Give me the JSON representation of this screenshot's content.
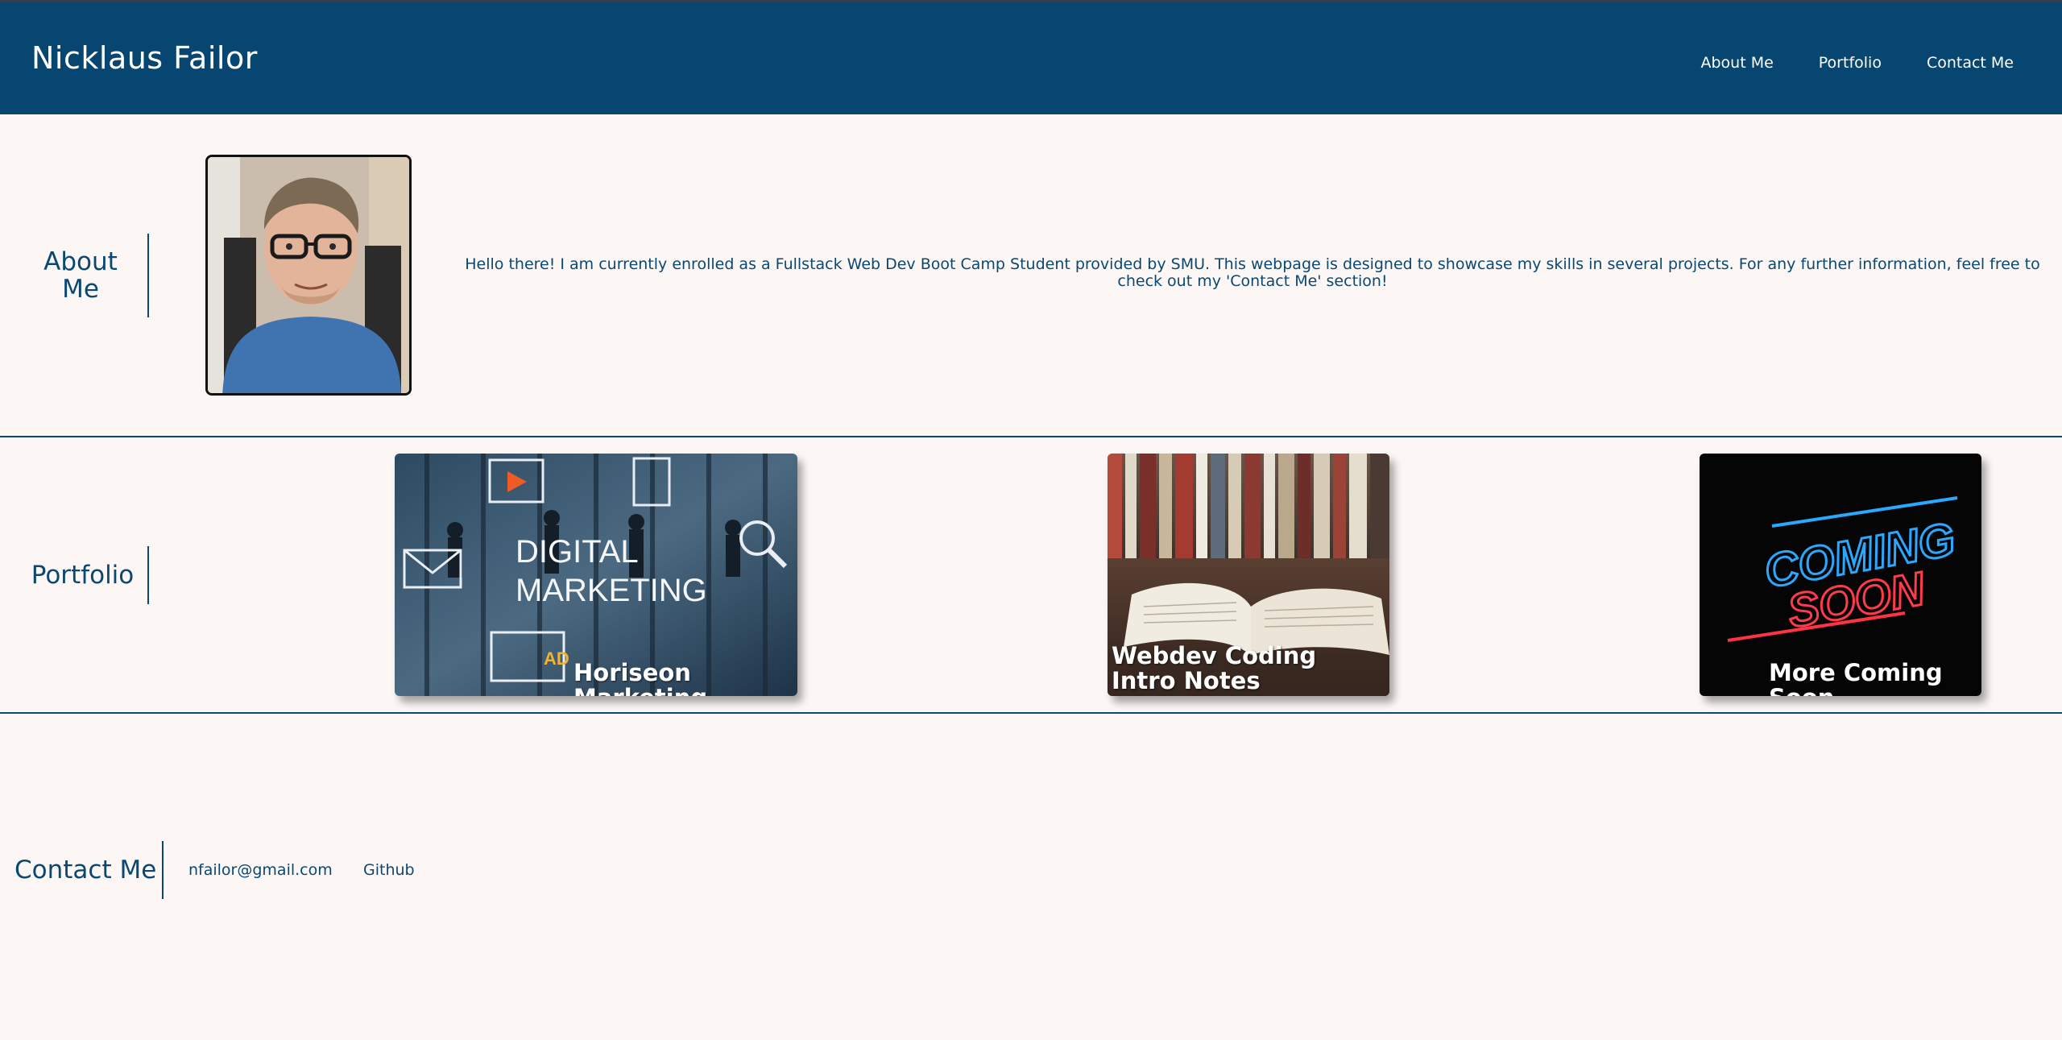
{
  "header": {
    "title": "Nicklaus Failor",
    "nav": [
      "About Me",
      "Portfolio",
      "Contact Me"
    ]
  },
  "about": {
    "heading_line1": "About",
    "heading_line2": "Me",
    "text": "Hello there! I am currently enrolled as a Fullstack Web Dev Boot Camp Student provided by SMU. This webpage is designed to showcase my skills in several projects. For any further information, feel free to check out my 'Contact Me' section!"
  },
  "portfolio": {
    "heading": "Portfolio",
    "cards": [
      {
        "caption": "Horiseon Marketing",
        "image_text": [
          "DIGITAL",
          "MARKETING"
        ],
        "icon": "digital-marketing-image"
      },
      {
        "caption": "Webdev Coding Intro Notes",
        "icon": "open-book-image"
      },
      {
        "caption": "More Coming Soon",
        "image_text": [
          "COMING",
          "SOON"
        ],
        "icon": "coming-soon-neon-image"
      }
    ]
  },
  "contact": {
    "heading": "Contact Me",
    "email": "nfailor@gmail.com",
    "github": "Github"
  },
  "colors": {
    "header_bg": "#064671",
    "page_bg": "#fcf7f5",
    "accent": "#0a4872"
  }
}
